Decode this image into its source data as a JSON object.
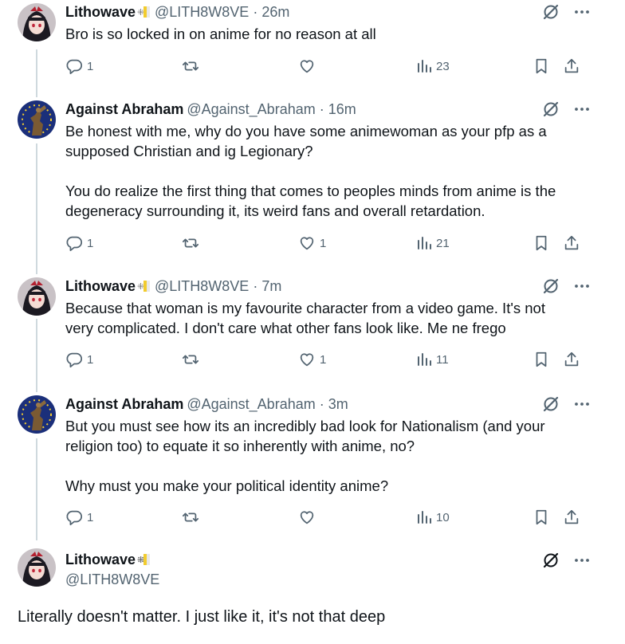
{
  "tweets": [
    {
      "name": "Lithowave",
      "handle": "@LITH8W8VE",
      "time": "26m",
      "lines": [
        "Bro is so locked in on anime for no reason at all"
      ],
      "reply_count": "1",
      "retweet_count": "",
      "like_count": "",
      "view_count": "23"
    },
    {
      "name": "Against Abraham",
      "handle": "@Against_Abraham",
      "time": "16m",
      "lines": [
        "Be honest with me, why do you have some animewoman as your pfp as a",
        "supposed Christian and ig Legionary?",
        "You do realize the first thing that comes to peoples minds from anime is the",
        "degeneracy surrounding it, its weird fans and overall retardation."
      ],
      "reply_count": "1",
      "retweet_count": "",
      "like_count": "1",
      "view_count": "21"
    },
    {
      "name": "Lithowave",
      "handle": "@LITH8W8VE",
      "time": "7m",
      "lines": [
        "Because that woman is my favourite character from a video game. It's not",
        "very complicated. I don't care what other fans look like. Me ne frego"
      ],
      "reply_count": "1",
      "retweet_count": "",
      "like_count": "1",
      "view_count": "11"
    },
    {
      "name": "Against Abraham",
      "handle": "@Against_Abraham",
      "time": "3m",
      "lines": [
        "But you must see how its an incredibly bad look for Nationalism (and your",
        "religion too) to equate it so inherently with anime, no?",
        "Why must you make your political identity anime?"
      ],
      "reply_count": "1",
      "retweet_count": "",
      "like_count": "",
      "view_count": "10"
    }
  ],
  "focused": {
    "name": "Lithowave",
    "handle": "@LITH8W8VE",
    "text": "Literally doesn't matter. I just like it, it's not that deep"
  },
  "separator": "·",
  "icons": {
    "grok": "grok-icon",
    "more": "more-icon",
    "reply": "reply-icon",
    "retweet": "retweet-icon",
    "like": "like-icon",
    "views": "views-icon",
    "bookmark": "bookmark-icon",
    "share": "share-icon",
    "flag_badge": "flag-badge-icon"
  },
  "colors": {
    "text": "#0f1419",
    "secondary": "#536471",
    "thread_line": "#cfd9de",
    "flag_yellow": "#f2cc2e",
    "flag_white": "#e8e8e8"
  }
}
